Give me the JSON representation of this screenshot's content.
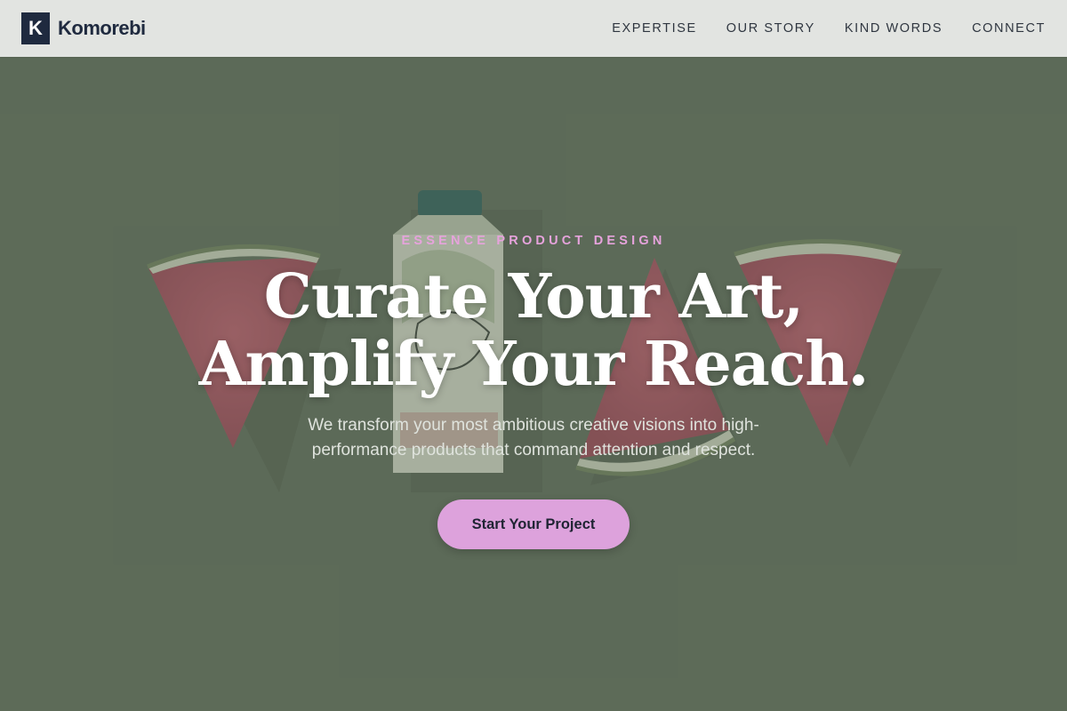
{
  "brand": {
    "mark": "K",
    "name": "Komorebi"
  },
  "nav": {
    "items": [
      {
        "label": "EXPERTISE"
      },
      {
        "label": "OUR STORY"
      },
      {
        "label": "KIND WORDS"
      },
      {
        "label": "CONNECT"
      }
    ]
  },
  "hero": {
    "eyebrow": "ESSENCE PRODUCT DESIGN",
    "headline": "Curate Your Art, Amplify Your Reach.",
    "subhead": "We transform your most ambitious creative visions into high-performance products that command attention and respect.",
    "cta_label": "Start Your Project",
    "background_image": "watermelon-slices-and-juice-carton-photo"
  },
  "colors": {
    "header_bg": "#e2e4e1",
    "hero_bg": "#5d6b58",
    "accent": "#dda2dc",
    "brand_dark": "#1f2a3f"
  }
}
